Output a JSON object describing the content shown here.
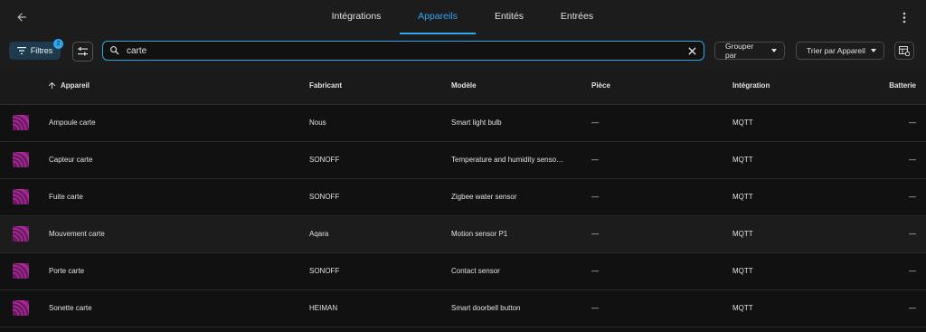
{
  "nav": {
    "tabs": [
      {
        "label": "Intégrations"
      },
      {
        "label": "Appareils"
      },
      {
        "label": "Entités"
      },
      {
        "label": "Entrées"
      }
    ],
    "active_tab": "Appareils"
  },
  "toolbar": {
    "filters_label": "Filtres",
    "filters_count": "2",
    "search_value": "carte",
    "group_by_label": "Grouper par",
    "sort_by_label": "Trier par Appareil"
  },
  "table": {
    "columns": {
      "device": "Appareil",
      "manufacturer": "Fabricant",
      "model": "Modèle",
      "area": "Pièce",
      "integration": "Intégration",
      "battery": "Batterie"
    },
    "rows": [
      {
        "device": "Ampoule carte",
        "manufacturer": "Nous",
        "model": "Smart light bulb",
        "area": "—",
        "integration": "MQTT",
        "battery": "—"
      },
      {
        "device": "Capteur carte",
        "manufacturer": "SONOFF",
        "model": "Temperature and humidity senso…",
        "area": "—",
        "integration": "MQTT",
        "battery": "—"
      },
      {
        "device": "Fuite carte",
        "manufacturer": "SONOFF",
        "model": "Zigbee water sensor",
        "area": "—",
        "integration": "MQTT",
        "battery": "—"
      },
      {
        "device": "Mouvement carte",
        "manufacturer": "Aqara",
        "model": "Motion sensor P1",
        "area": "—",
        "integration": "MQTT",
        "battery": "—"
      },
      {
        "device": "Porte carte",
        "manufacturer": "SONOFF",
        "model": "Contact sensor",
        "area": "—",
        "integration": "MQTT",
        "battery": "—"
      },
      {
        "device": "Sonette carte",
        "manufacturer": "HEIMAN",
        "model": "Smart doorbell button",
        "area": "—",
        "integration": "MQTT",
        "battery": "—"
      }
    ]
  },
  "colors": {
    "accent": "#2fa7e8",
    "device_icon": "#7b1f6e"
  },
  "icons": {
    "back": "arrow-left-icon",
    "overflow": "dots-vertical-icon",
    "filter": "filter-icon",
    "settings": "tune-icon",
    "search": "search-icon",
    "clear": "close-icon",
    "columns": "table-cog-icon",
    "sort": "arrow-up-icon",
    "device": "mqtt-icon"
  }
}
